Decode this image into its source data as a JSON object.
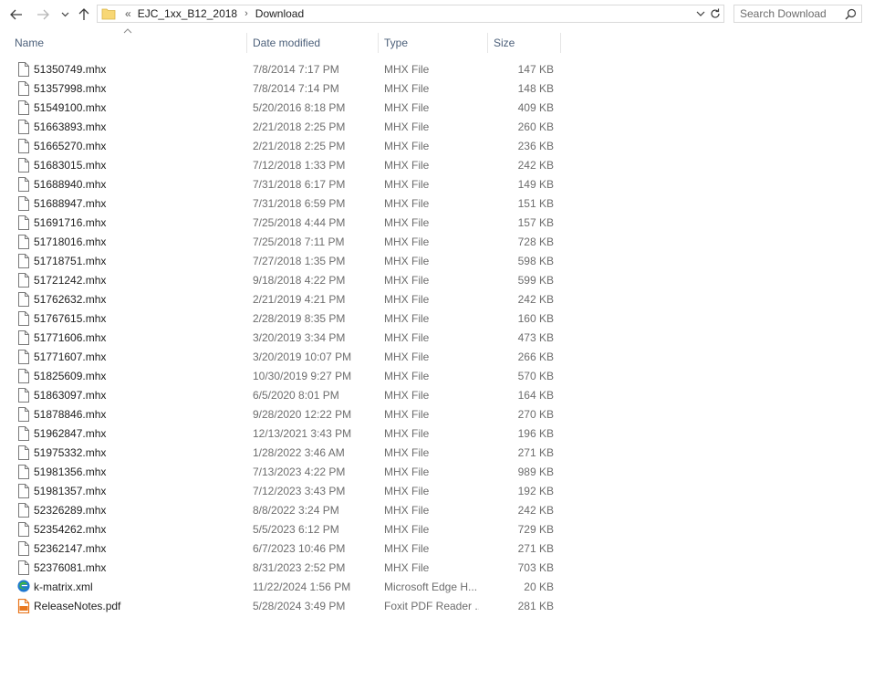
{
  "navigation": {
    "back_icon": "back-arrow-icon",
    "forward_icon": "forward-arrow-icon",
    "recent_icon": "chevron-down-icon",
    "up_icon": "up-arrow-icon"
  },
  "address": {
    "overflow": "«",
    "crumbs": [
      "EJC_1xx_B12_2018",
      "Download"
    ],
    "separator": "›"
  },
  "search": {
    "placeholder": "Search Download"
  },
  "columns": {
    "name": "Name",
    "date": "Date modified",
    "type": "Type",
    "size": "Size"
  },
  "files": [
    {
      "name": "51350749.mhx",
      "date": "7/8/2014 7:17 PM",
      "type": "MHX File",
      "size": "147 KB",
      "icon": "file"
    },
    {
      "name": "51357998.mhx",
      "date": "7/8/2014 7:14 PM",
      "type": "MHX File",
      "size": "148 KB",
      "icon": "file"
    },
    {
      "name": "51549100.mhx",
      "date": "5/20/2016 8:18 PM",
      "type": "MHX File",
      "size": "409 KB",
      "icon": "file"
    },
    {
      "name": "51663893.mhx",
      "date": "2/21/2018 2:25 PM",
      "type": "MHX File",
      "size": "260 KB",
      "icon": "file"
    },
    {
      "name": "51665270.mhx",
      "date": "2/21/2018 2:25 PM",
      "type": "MHX File",
      "size": "236 KB",
      "icon": "file"
    },
    {
      "name": "51683015.mhx",
      "date": "7/12/2018 1:33 PM",
      "type": "MHX File",
      "size": "242 KB",
      "icon": "file"
    },
    {
      "name": "51688940.mhx",
      "date": "7/31/2018 6:17 PM",
      "type": "MHX File",
      "size": "149 KB",
      "icon": "file"
    },
    {
      "name": "51688947.mhx",
      "date": "7/31/2018 6:59 PM",
      "type": "MHX File",
      "size": "151 KB",
      "icon": "file"
    },
    {
      "name": "51691716.mhx",
      "date": "7/25/2018 4:44 PM",
      "type": "MHX File",
      "size": "157 KB",
      "icon": "file"
    },
    {
      "name": "51718016.mhx",
      "date": "7/25/2018 7:11 PM",
      "type": "MHX File",
      "size": "728 KB",
      "icon": "file"
    },
    {
      "name": "51718751.mhx",
      "date": "7/27/2018 1:35 PM",
      "type": "MHX File",
      "size": "598 KB",
      "icon": "file"
    },
    {
      "name": "51721242.mhx",
      "date": "9/18/2018 4:22 PM",
      "type": "MHX File",
      "size": "599 KB",
      "icon": "file"
    },
    {
      "name": "51762632.mhx",
      "date": "2/21/2019 4:21 PM",
      "type": "MHX File",
      "size": "242 KB",
      "icon": "file"
    },
    {
      "name": "51767615.mhx",
      "date": "2/28/2019 8:35 PM",
      "type": "MHX File",
      "size": "160 KB",
      "icon": "file"
    },
    {
      "name": "51771606.mhx",
      "date": "3/20/2019 3:34 PM",
      "type": "MHX File",
      "size": "473 KB",
      "icon": "file"
    },
    {
      "name": "51771607.mhx",
      "date": "3/20/2019 10:07 PM",
      "type": "MHX File",
      "size": "266 KB",
      "icon": "file"
    },
    {
      "name": "51825609.mhx",
      "date": "10/30/2019 9:27 PM",
      "type": "MHX File",
      "size": "570 KB",
      "icon": "file"
    },
    {
      "name": "51863097.mhx",
      "date": "6/5/2020 8:01 PM",
      "type": "MHX File",
      "size": "164 KB",
      "icon": "file"
    },
    {
      "name": "51878846.mhx",
      "date": "9/28/2020 12:22 PM",
      "type": "MHX File",
      "size": "270 KB",
      "icon": "file"
    },
    {
      "name": "51962847.mhx",
      "date": "12/13/2021 3:43 PM",
      "type": "MHX File",
      "size": "196 KB",
      "icon": "file"
    },
    {
      "name": "51975332.mhx",
      "date": "1/28/2022 3:46 AM",
      "type": "MHX File",
      "size": "271 KB",
      "icon": "file"
    },
    {
      "name": "51981356.mhx",
      "date": "7/13/2023 4:22 PM",
      "type": "MHX File",
      "size": "989 KB",
      "icon": "file"
    },
    {
      "name": "51981357.mhx",
      "date": "7/12/2023 3:43 PM",
      "type": "MHX File",
      "size": "192 KB",
      "icon": "file"
    },
    {
      "name": "52326289.mhx",
      "date": "8/8/2022 3:24 PM",
      "type": "MHX File",
      "size": "242 KB",
      "icon": "file"
    },
    {
      "name": "52354262.mhx",
      "date": "5/5/2023 6:12 PM",
      "type": "MHX File",
      "size": "729 KB",
      "icon": "file"
    },
    {
      "name": "52362147.mhx",
      "date": "6/7/2023 10:46 PM",
      "type": "MHX File",
      "size": "271 KB",
      "icon": "file"
    },
    {
      "name": "52376081.mhx",
      "date": "8/31/2023 2:52 PM",
      "type": "MHX File",
      "size": "703 KB",
      "icon": "file"
    },
    {
      "name": "k-matrix.xml",
      "date": "11/22/2024 1:56 PM",
      "type": "Microsoft Edge H...",
      "size": "20 KB",
      "icon": "edge"
    },
    {
      "name": "ReleaseNotes.pdf",
      "date": "5/28/2024 3:49 PM",
      "type": "Foxit PDF Reader ...",
      "size": "281 KB",
      "icon": "pdf"
    }
  ],
  "colors": {
    "header_text": "#4c607a",
    "muted_text": "#6d6d6d",
    "folder": "#f8d775",
    "edge_blue": "#1f78d1",
    "edge_green": "#3bb54a",
    "pdf_orange": "#e8771e"
  }
}
